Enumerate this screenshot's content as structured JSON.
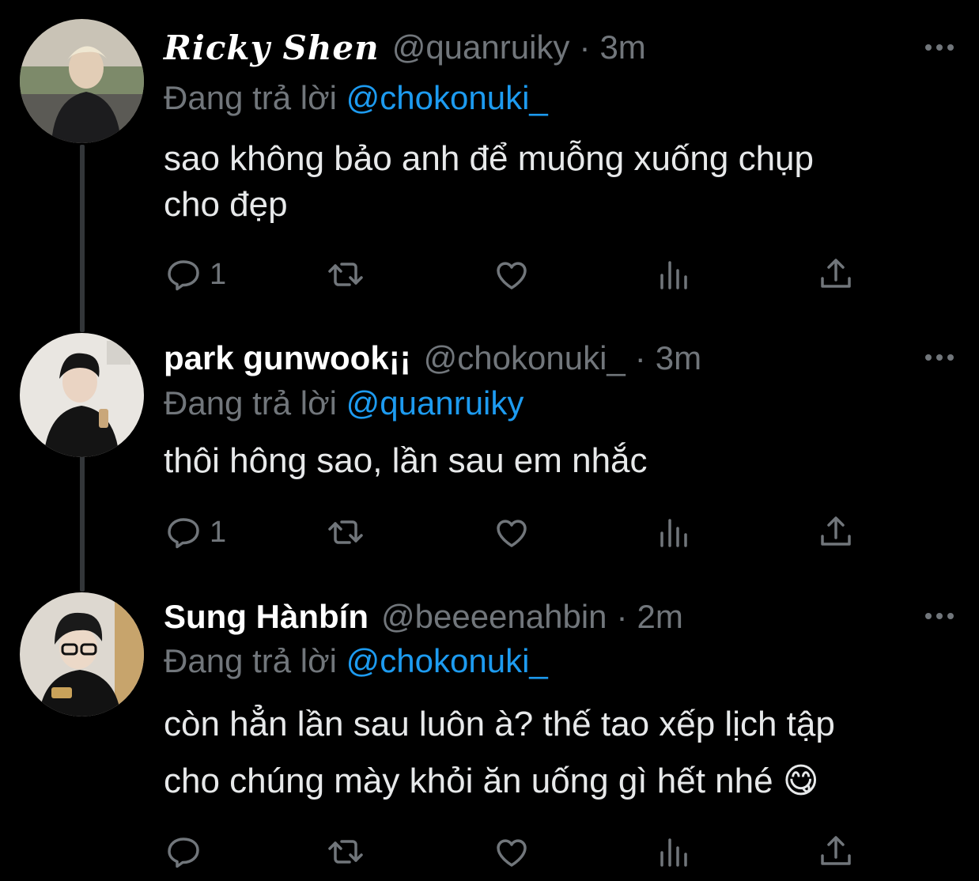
{
  "tweets": [
    {
      "name": "Ricky Shen",
      "handle": "@quanruiky",
      "time": "3m",
      "reply_prefix": "Đang trả lời",
      "reply_to": "@chokonuki_",
      "text_lines": [
        "sao không bảo anh để muỗng xuống chụp",
        "cho đẹp"
      ],
      "reply_count": "1"
    },
    {
      "name": "park gunwook¡¡",
      "handle": "@chokonuki_",
      "time": "3m",
      "reply_prefix": "Đang trả lời",
      "reply_to": "@quanruiky",
      "text_lines": [
        "thôi hông sao, lần sau em nhắc"
      ],
      "reply_count": "1"
    },
    {
      "name": "Sung Hànbín",
      "handle": "@beeeenahbin",
      "time": "2m",
      "reply_prefix": "Đang trả lời",
      "reply_to": "@chokonuki_",
      "text_lines": [
        "còn hẳn lần sau luôn à? thế tao xếp lịch tập",
        "cho chúng mày khỏi ăn uống gì hết nhé 😋"
      ],
      "reply_count": ""
    }
  ],
  "separator_dot": "·",
  "icons": {
    "more": "more-horizontal-icon",
    "reply": "reply-bubble-icon",
    "retweet": "retweet-icon",
    "like": "heart-icon",
    "views": "views-bar-chart-icon",
    "share": "share-upload-icon"
  },
  "colors": {
    "background": "#000000",
    "text": "#e7e9ea",
    "muted": "#71767b",
    "link": "#1d9bf0",
    "thread_line": "#333639"
  }
}
